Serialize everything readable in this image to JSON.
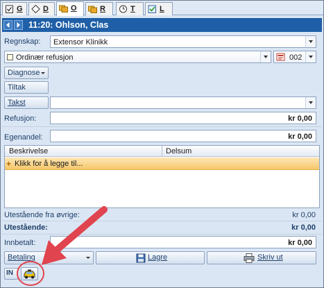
{
  "tabs": [
    {
      "label": "G",
      "icon": "clipboard-check-icon",
      "active": false
    },
    {
      "label": "D",
      "icon": "diamond-icon",
      "active": false
    },
    {
      "label": "O",
      "icon": "folders-icon",
      "active": true
    },
    {
      "label": "R",
      "icon": "folders-icon",
      "active": false
    },
    {
      "label": "T",
      "icon": "clock-icon",
      "active": false
    },
    {
      "label": "L",
      "icon": "checklist-icon",
      "active": false
    }
  ],
  "header": {
    "title": "11:20: Ohlson, Clas"
  },
  "form": {
    "regnskap_label": "Regnskap:",
    "regnskap_value": "Extensor Klinikk",
    "type_value": "Ordinær refusjon",
    "code_value": "002",
    "diagnose_label": "Diagnose",
    "tiltak_label": "Tiltak",
    "takst_label": "Takst",
    "takst_value": "",
    "refusjon_label": "Refusjon:",
    "refusjon_value": "kr 0,00",
    "egenandel_label": "Egenandel:",
    "egenandel_value": "kr 0,00"
  },
  "grid": {
    "col_description": "Beskrivelse",
    "col_amount": "Delsum",
    "new_row_text": "Klikk for å legge til..."
  },
  "summary": {
    "other_outstanding_label": "Utestående fra øvrige:",
    "other_outstanding_value": "kr 0,00",
    "outstanding_label": "Utestående:",
    "outstanding_value": "kr 0,00",
    "paid_label": "Innbetalt:",
    "paid_value": "kr 0,00"
  },
  "actions": {
    "payment_label": "Betaling",
    "save_label": "Lagre",
    "print_label": "Skriv ut",
    "in_label": "IN"
  },
  "colors": {
    "header_bg": "#1f5fa7",
    "annotation": "#e0444e",
    "new_row": "#f6c76a"
  }
}
